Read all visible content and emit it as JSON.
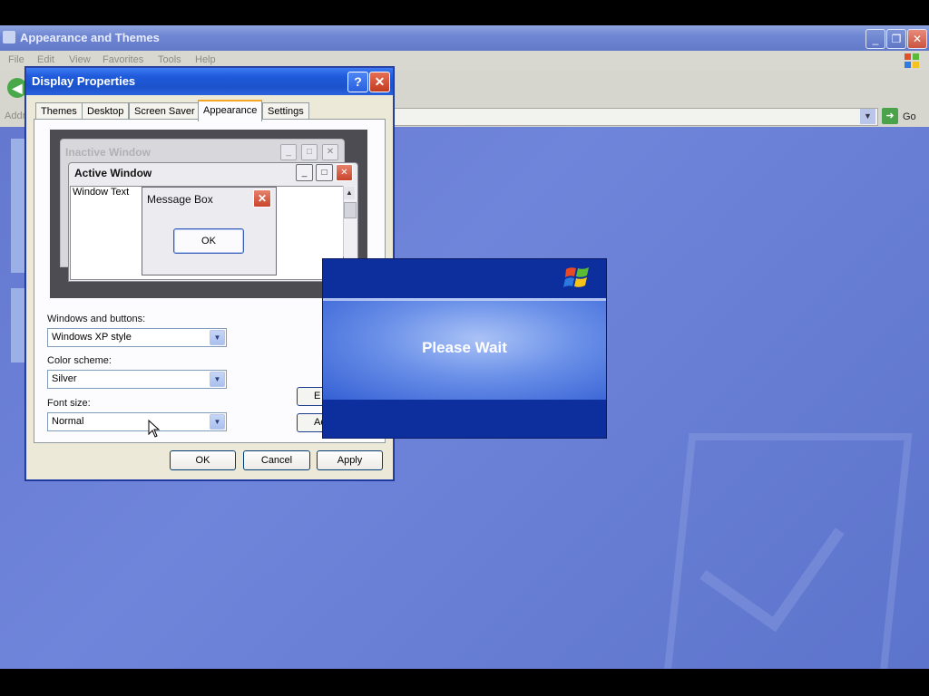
{
  "explorer": {
    "title": "Appearance and Themes",
    "menu": [
      "File",
      "Edit",
      "View",
      "Favorites",
      "Tools",
      "Help"
    ],
    "address_label": "Addr",
    "go_label": "Go"
  },
  "dialog": {
    "title": "Display Properties",
    "tabs": [
      "Themes",
      "Desktop",
      "Screen Saver",
      "Appearance",
      "Settings"
    ],
    "active_tab": "Appearance",
    "preview": {
      "inactive_window_title": "Inactive Window",
      "active_window_title": "Active Window",
      "window_text": "Window Text",
      "message_box_title": "Message Box",
      "message_box_ok": "OK"
    },
    "windows_and_buttons_label": "Windows and buttons:",
    "windows_and_buttons_value": "Windows XP style",
    "color_scheme_label": "Color scheme:",
    "color_scheme_value": "Silver",
    "font_size_label": "Font size:",
    "font_size_value": "Normal",
    "effects_button_partial": "E",
    "advanced_button_partial": "Ac",
    "ok_button": "OK",
    "cancel_button": "Cancel",
    "apply_button": "Apply"
  },
  "splash": {
    "message": "Please Wait"
  },
  "colors": {
    "xp_title_blue": "#1f5bdc",
    "splash_dark_blue": "#0d2f9e",
    "desktop_blue": "#6b83d6",
    "close_red": "#c9442c"
  }
}
